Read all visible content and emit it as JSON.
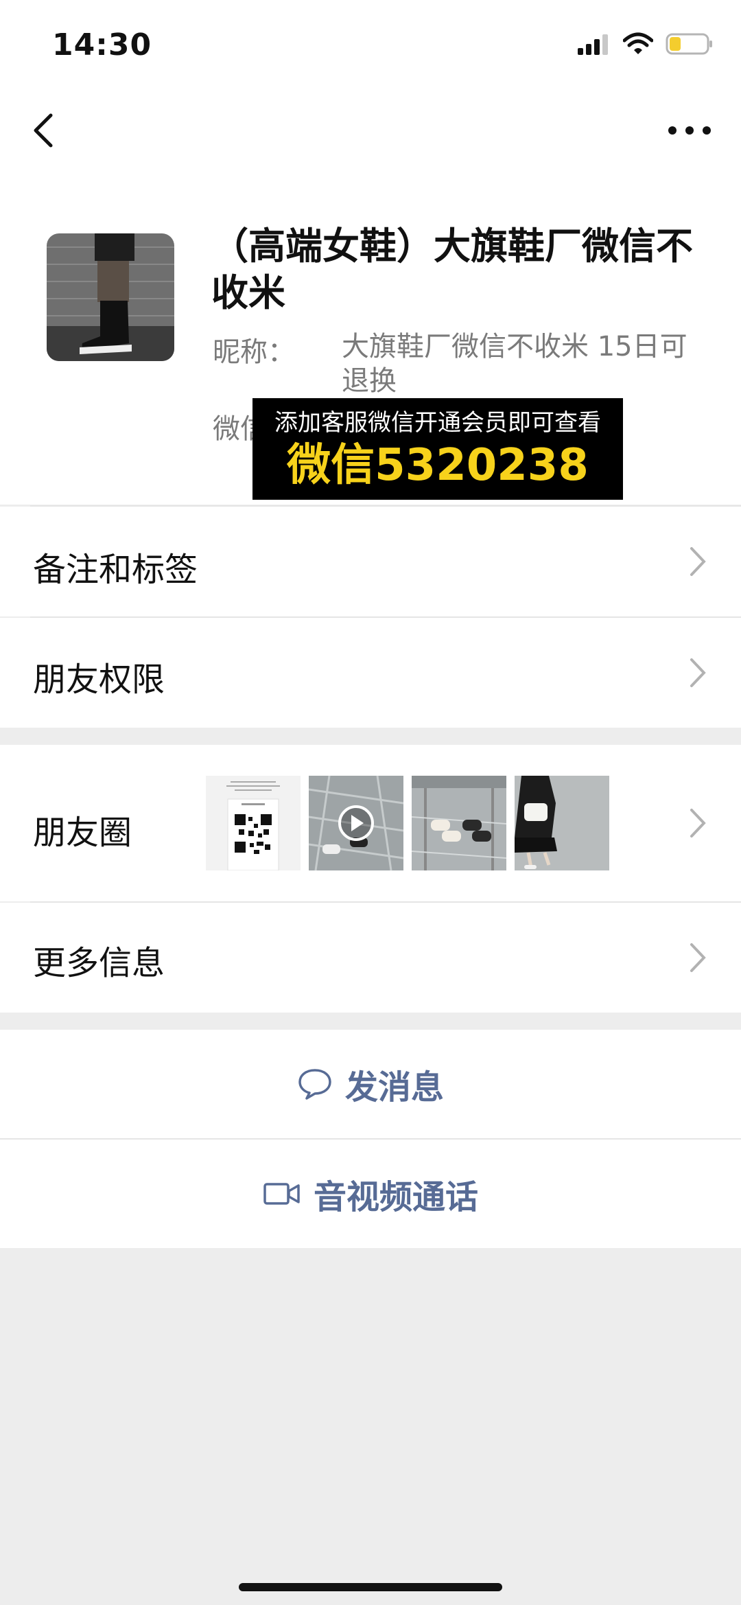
{
  "status_bar": {
    "time": "14:30"
  },
  "profile": {
    "title": "（高端女鞋）大旗鞋厂微信不收米",
    "nickname_label": "昵称：",
    "nickname_value": "大旗鞋厂微信不收米 15日可退换",
    "wechat_label": "微信"
  },
  "overlay": {
    "line1": "添加客服微信开通会员即可查看",
    "line2": "微信5320238"
  },
  "rows": {
    "remarks": "备注和标签",
    "permissions": "朋友权限",
    "moments": "朋友圈",
    "more_info": "更多信息"
  },
  "actions": {
    "message": "发消息",
    "call": "音视频通话"
  },
  "colors": {
    "link": "#576b95",
    "overlay_accent": "#f7d21b"
  }
}
